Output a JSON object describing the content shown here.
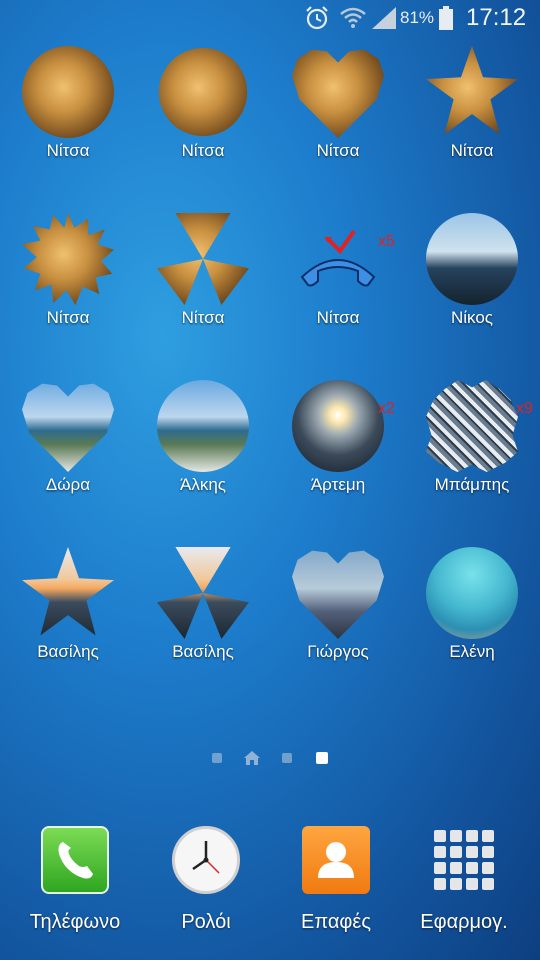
{
  "status_bar": {
    "battery_percent": "81%",
    "time": "17:12",
    "icons": [
      "alarm-icon",
      "wifi-icon",
      "signal-icon",
      "battery-icon"
    ]
  },
  "contacts": [
    {
      "name": "Νίτσα",
      "shape": "circle",
      "photo": "dog"
    },
    {
      "name": "Νίτσα",
      "shape": "clover",
      "photo": "dog"
    },
    {
      "name": "Νίτσα",
      "shape": "heart",
      "photo": "dog"
    },
    {
      "name": "Νίτσα",
      "shape": "star",
      "photo": "dog"
    },
    {
      "name": "Νίτσα",
      "shape": "burst",
      "photo": "dog"
    },
    {
      "name": "Νίτσα",
      "shape": "radiation",
      "photo": "dog"
    },
    {
      "name": "Νίτσα",
      "shape": "missed-call",
      "photo": "missed-call-icon",
      "badge": "x5"
    },
    {
      "name": "Νίκος",
      "shape": "circle",
      "photo": "lake"
    },
    {
      "name": "Δώρα",
      "shape": "heart",
      "photo": "beach"
    },
    {
      "name": "Άλκης",
      "shape": "circle",
      "photo": "beach"
    },
    {
      "name": "Άρτεμη",
      "shape": "circle",
      "photo": "night",
      "badge": "x2"
    },
    {
      "name": "Μπάμπης",
      "shape": "bubble",
      "photo": "stones",
      "badge": "x9"
    },
    {
      "name": "Βασίλης",
      "shape": "star",
      "photo": "sunset2"
    },
    {
      "name": "Βασίλης",
      "shape": "radiation",
      "photo": "sunset2"
    },
    {
      "name": "Γιώργος",
      "shape": "heart",
      "photo": "greece"
    },
    {
      "name": "Ελένη",
      "shape": "circle",
      "photo": "sea"
    }
  ],
  "pager": {
    "pages": 4,
    "home_index": 1,
    "active_index": 3
  },
  "dock": [
    {
      "label": "Τηλέφωνο",
      "icon": "phone-icon"
    },
    {
      "label": "Ρολόι",
      "icon": "clock-icon"
    },
    {
      "label": "Επαφές",
      "icon": "contacts-icon"
    },
    {
      "label": "Εφαρμογ.",
      "icon": "apps-icon"
    }
  ],
  "colors": {
    "badge": "#e02222",
    "background": "#1d7dcc"
  }
}
